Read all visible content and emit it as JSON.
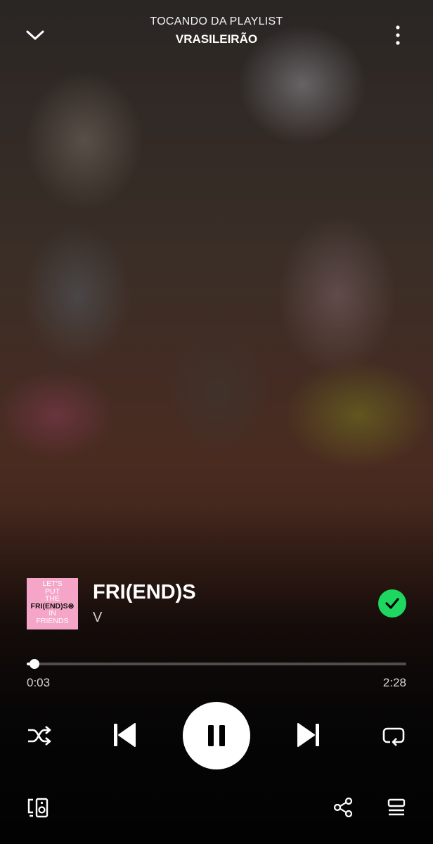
{
  "header": {
    "context_label": "TOCANDO DA PLAYLIST",
    "playlist_name": "VRASILEIRÃO",
    "collapse_icon": "chevron-down-icon",
    "menu_icon": "more-vertical-icon"
  },
  "track": {
    "title": "FRI(END)S",
    "artist": "V",
    "cover_text_lines": [
      "LET'S",
      "PUT",
      "THE",
      "FRI(END)S⊗",
      "IN",
      "FRIENDS"
    ],
    "liked": true
  },
  "progress": {
    "elapsed": "0:03",
    "total": "2:28",
    "fraction": 0.02
  },
  "controls": {
    "shuffle_icon": "shuffle-icon",
    "previous_icon": "skip-previous-icon",
    "play_pause_icon": "pause-icon",
    "next_icon": "skip-next-icon",
    "repeat_icon": "repeat-icon"
  },
  "bottom_bar": {
    "devices_icon": "connect-device-icon",
    "share_icon": "share-icon",
    "queue_icon": "queue-icon"
  },
  "colors": {
    "accent": "#1ed760",
    "cover_bg": "#f5a6c8"
  }
}
